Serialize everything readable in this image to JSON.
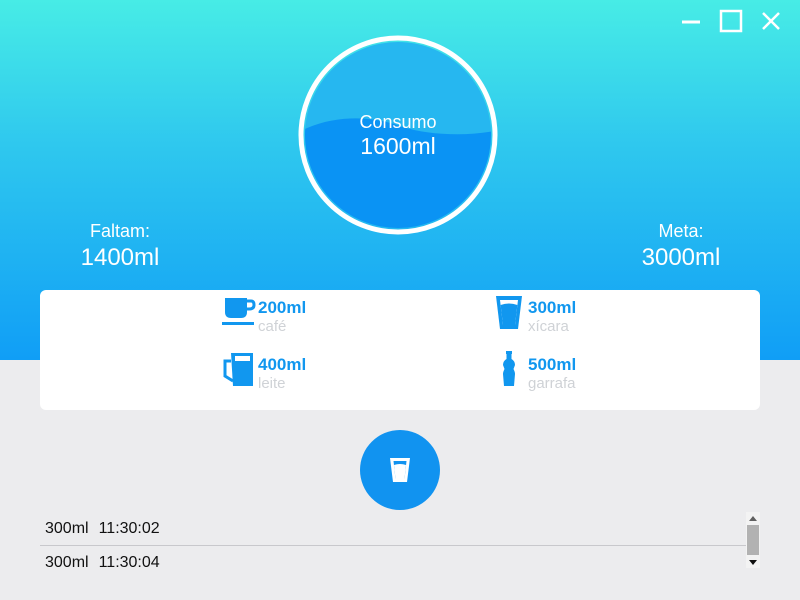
{
  "window_controls": {
    "minimize_icon": "minimize-icon",
    "maximize_icon": "maximize-icon",
    "close_icon": "close-icon"
  },
  "gauge": {
    "label": "Consumo",
    "value": "1600ml",
    "fill_fraction": 0.53
  },
  "stats": {
    "remaining": {
      "label": "Faltam:",
      "value": "1400ml"
    },
    "goal": {
      "label": "Meta:",
      "value": "3000ml"
    }
  },
  "cup_options": [
    {
      "amount": "200ml",
      "name": "café",
      "icon": "coffee-cup-icon"
    },
    {
      "amount": "300ml",
      "name": "xícara",
      "icon": "glass-icon"
    },
    {
      "amount": "400ml",
      "name": "leite",
      "icon": "milk-jug-icon"
    },
    {
      "amount": "500ml",
      "name": "garrafa",
      "icon": "bottle-icon"
    }
  ],
  "drink_button": {
    "icon": "glass-icon"
  },
  "history": [
    {
      "amount": "300ml",
      "time": "11:30:02"
    },
    {
      "amount": "300ml",
      "time": "11:30:04"
    }
  ],
  "colors": {
    "accent": "#1193f0",
    "gradient_top": "#47ece6",
    "gradient_bottom": "#109ef6",
    "background": "#ececee"
  }
}
